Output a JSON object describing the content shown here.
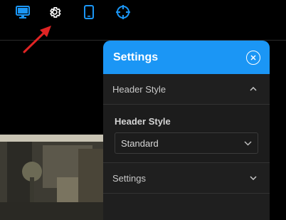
{
  "toolbar": {
    "icons": [
      {
        "name": "desktop-icon",
        "color": "#1b96f5"
      },
      {
        "name": "gear-icon",
        "color": "#ffffff"
      },
      {
        "name": "tablet-icon",
        "color": "#1b96f5"
      },
      {
        "name": "crosshair-icon",
        "color": "#1b96f5"
      }
    ]
  },
  "annotation": {
    "arrow_color": "#e02424"
  },
  "panel": {
    "title": "Settings",
    "accent_color": "#1b96f5",
    "sections": [
      {
        "label": "Header Style",
        "expanded": true
      },
      {
        "label": "Settings",
        "expanded": false
      }
    ],
    "header_style_field": {
      "label": "Header Style",
      "value": "Standard"
    }
  }
}
